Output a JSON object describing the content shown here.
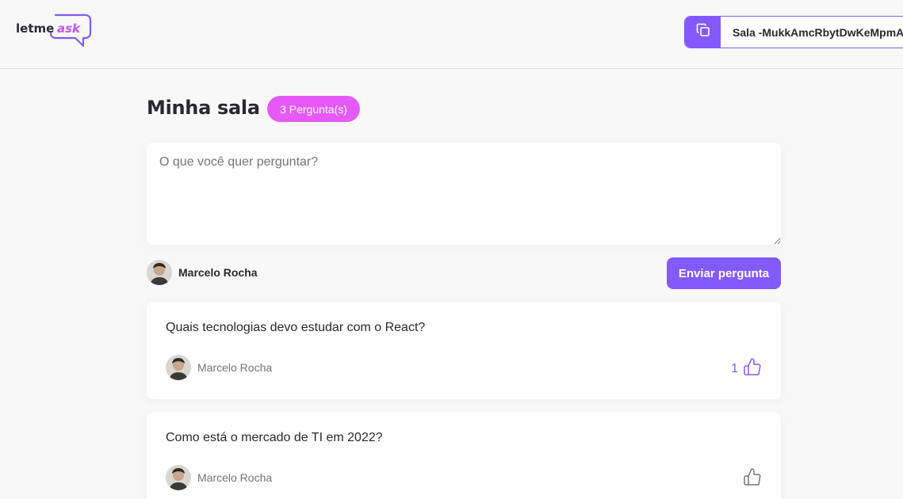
{
  "header": {
    "logo": {
      "prefix": "letme",
      "suffix": "ask"
    },
    "room_code": {
      "label": "Sala -MukkAmcRbytDwKeMpmA",
      "icon": "copy-icon"
    }
  },
  "room": {
    "title": "Minha sala",
    "question_count_label": "3 Pergunta(s)"
  },
  "form": {
    "placeholder": "O que você quer perguntar?",
    "value": "",
    "user_name": "Marcelo Rocha",
    "submit_label": "Enviar pergunta"
  },
  "questions": [
    {
      "content": "Quais tecnologias devo estudar com o React?",
      "author": "Marcelo Rocha",
      "like_count": "1",
      "liked": true
    },
    {
      "content": "Como está o mercado de TI em 2022?",
      "author": "Marcelo Rocha",
      "like_count": "",
      "liked": false
    }
  ],
  "colors": {
    "accent": "#835afd",
    "badge": "#e559f9",
    "background": "#f8f8f8",
    "text": "#29292e",
    "muted": "#737380"
  }
}
